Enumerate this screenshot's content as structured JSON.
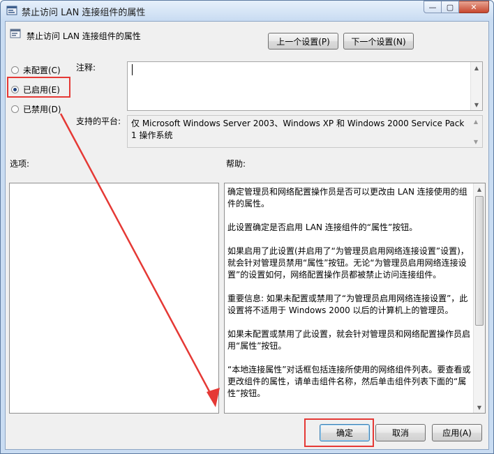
{
  "window": {
    "title": "禁止访问 LAN 连接组件的属性",
    "caption_min": "—",
    "caption_max": "▢",
    "caption_close": "✕"
  },
  "header": {
    "title": "禁止访问 LAN 连接组件的属性",
    "prev_setting_label": "上一个设置(P)",
    "next_setting_label": "下一个设置(N)"
  },
  "state": {
    "options": [
      {
        "label": "未配置(C)",
        "selected": false
      },
      {
        "label": "已启用(E)",
        "selected": true
      },
      {
        "label": "已禁用(D)",
        "selected": false
      }
    ]
  },
  "comment": {
    "label": "注释:",
    "value": ""
  },
  "platform": {
    "label": "支持的平台:",
    "text": "仅 Microsoft Windows Server 2003、Windows XP 和 Windows 2000 Service Pack 1 操作系统"
  },
  "options_panel": {
    "label": "选项:"
  },
  "help_panel": {
    "label": "帮助:",
    "paragraphs": [
      "确定管理员和网络配置操作员是否可以更改由 LAN 连接使用的组件的属性。",
      "此设置确定是否启用 LAN 连接组件的“属性”按钮。",
      "如果启用了此设置(并启用了“为管理员启用网络连接设置”设置)，就会针对管理员禁用“属性”按钮。无论“为管理员启用网络连接设置”的设置如何，网络配置操作员都被禁止访问连接组件。",
      "重要信息: 如果未配置或禁用了“为管理员启用网络连接设置”，此设置将不适用于 Windows 2000 以后的计算机上的管理员。",
      "如果未配置或禁用了此设置，就会针对管理员和网络配置操作员启用“属性”按钮。",
      "“本地连接属性”对话框包括连接所使用的网络组件列表。要查看或更改组件的属性，请单击组件名称，然后单击组件列表下面的“属性”按钮。"
    ]
  },
  "footer": {
    "ok_label": "确定",
    "cancel_label": "取消",
    "apply_label": "应用(A)"
  },
  "annotation": {
    "color": "#e53935"
  }
}
